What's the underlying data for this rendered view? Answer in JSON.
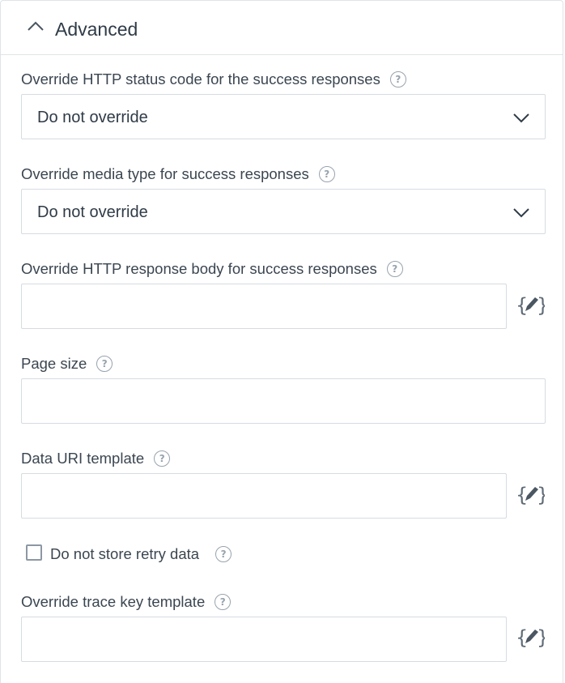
{
  "section": {
    "title": "Advanced",
    "expanded": true,
    "toggle_icon": "chevron-up-icon"
  },
  "fields": {
    "status_code": {
      "label": "Override HTTP status code for the success responses",
      "value": "Do not override"
    },
    "media_type": {
      "label": "Override media type for success responses",
      "value": "Do not override"
    },
    "response_body": {
      "label": "Override HTTP response body for success responses",
      "value": ""
    },
    "page_size": {
      "label": "Page size",
      "value": ""
    },
    "data_uri": {
      "label": "Data URI template",
      "value": ""
    },
    "retry": {
      "label": "Do not store retry data",
      "checked": false
    },
    "trace_key": {
      "label": "Override trace key template",
      "value": ""
    }
  },
  "icons": {
    "help": "help-icon",
    "expression_editor": "expression-editor-icon",
    "dropdown": "chevron-down-icon"
  },
  "colors": {
    "border": "#d6dce1",
    "text": "#2f3b47",
    "icon": "#98a3ad"
  }
}
